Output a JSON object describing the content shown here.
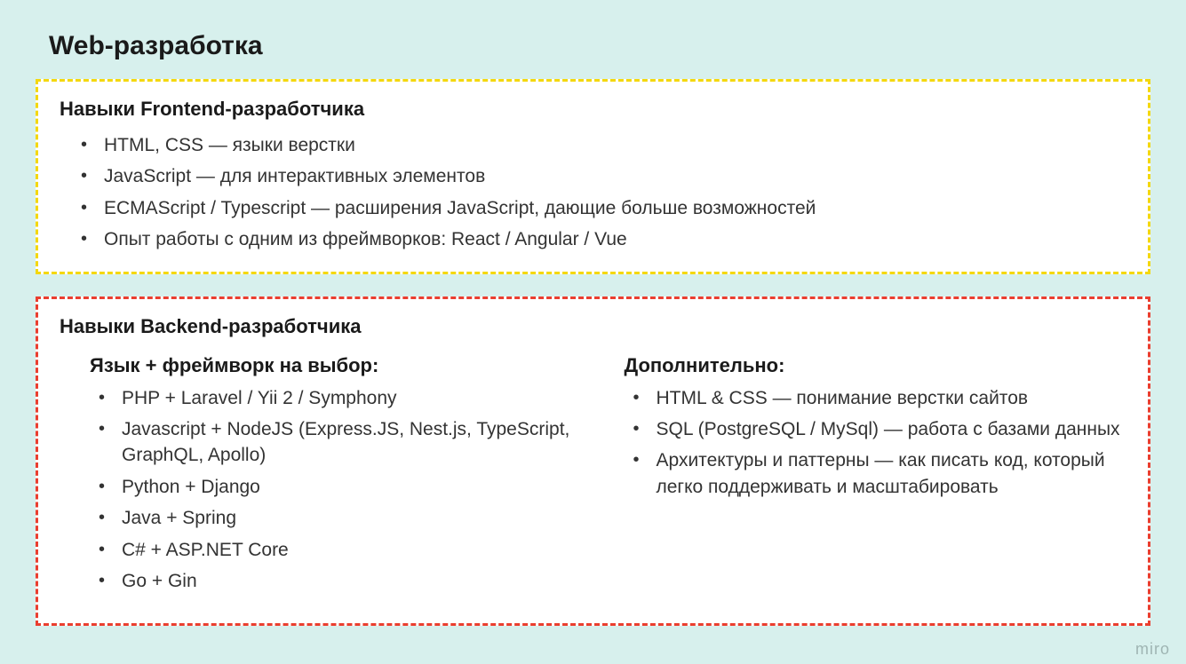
{
  "title": "Web-разработка",
  "frontend": {
    "heading": "Навыки Frontend-разработчика",
    "items": [
      "HTML, CSS — языки верстки",
      "JavaScript — для интерактивных элементов",
      "ECMAScript / Typescript — расширения JavaScript, дающие больше возможностей",
      "Опыт работы с одним из фреймворков: React / Angular / Vue"
    ]
  },
  "backend": {
    "heading": "Навыки Backend-разработчика",
    "langHeading": "Язык + фреймворк на выбор:",
    "langItems": [
      "PHP + Laravel / Yii 2 / Symphony",
      "Javascript + NodeJS (Express.JS, Nest.js, TypeScript, GraphQL, Apollo)",
      "Python + Django",
      "Java + Spring",
      "C# + ASP.NET Core",
      "Go + Gin"
    ],
    "extraHeading": "Дополнительно:",
    "extraItems": [
      "HTML & CSS — понимание верстки сайтов",
      "SQL (PostgreSQL / MySql) — работа с базами данных",
      "Архитектуры и паттерны — как писать код, который легко поддерживать и масштабировать"
    ]
  },
  "watermark": "miro"
}
